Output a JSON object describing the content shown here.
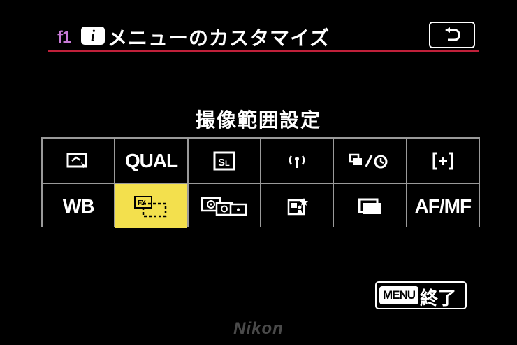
{
  "header": {
    "menu_code": "f1",
    "i_badge": "i",
    "title": "メニューのカスタマイズ",
    "back_icon": "return-arrow-icon"
  },
  "colors": {
    "accent_line": "#c0203a",
    "menu_code": "#c87ad6",
    "selected_cell": "#f3e04d",
    "grid_border": "#9a9a9a"
  },
  "caption": "撮像範囲設定",
  "grid": {
    "row1": [
      {
        "label": "",
        "icon": "picture-control-icon"
      },
      {
        "label": "QUAL",
        "icon": ""
      },
      {
        "label": "",
        "icon": "sl-icon"
      },
      {
        "label": "",
        "icon": "wireless-icon"
      },
      {
        "label": "",
        "icon": "release-mode-icon"
      },
      {
        "label": "",
        "icon": "exposure-compensation-icon"
      }
    ],
    "row2": [
      {
        "label": "WB",
        "icon": ""
      },
      {
        "label": "FX",
        "icon": "image-area-icon"
      },
      {
        "label": "",
        "icon": "metering-icon"
      },
      {
        "label": "",
        "icon": "vibration-reduction-icon"
      },
      {
        "label": "",
        "icon": "monitor-icon"
      },
      {
        "label": "AF/MF",
        "icon": ""
      }
    ],
    "selected": "image-area"
  },
  "footer": {
    "menu_badge": "MENU",
    "end_label": "終了"
  },
  "brand": "Nikon"
}
